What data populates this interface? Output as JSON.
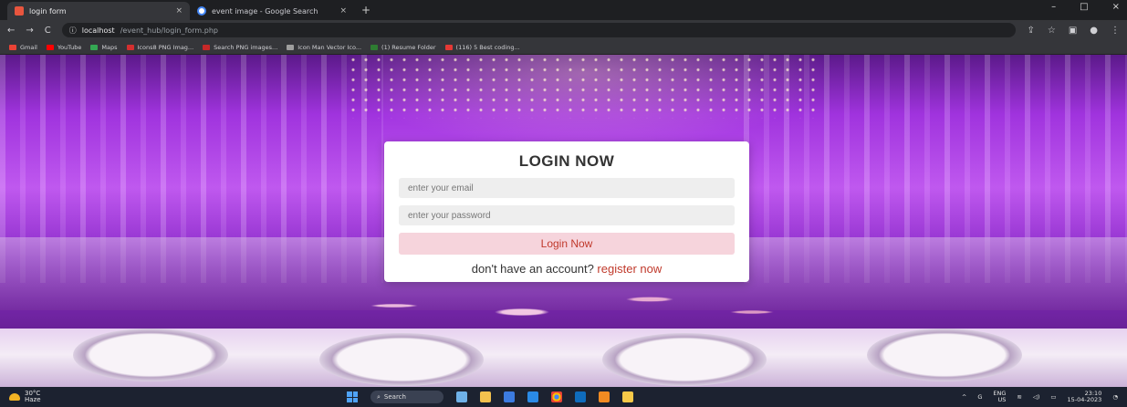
{
  "browser": {
    "tabs": [
      {
        "title": "login form",
        "active": true,
        "icon": "site-favicon"
      },
      {
        "title": "event image - Google Search",
        "active": false,
        "icon": "google-favicon"
      }
    ],
    "new_tab_symbol": "+",
    "close_symbol": "×",
    "window_controls": [
      "–",
      "□",
      "×"
    ],
    "url": {
      "host": "localhost",
      "path": "/event_hub/login_form.php"
    },
    "bookmarks": [
      "Gmail",
      "YouTube",
      "Maps",
      "Icons8 PNG Imag...",
      "Search PNG images...",
      "Icon Man Vector Ico...",
      "(1) Resume Folder",
      "(116) 5 Best coding..."
    ],
    "bookmark_colors": [
      "#ea4335",
      "#ff0000",
      "#34a853",
      "#d32f2f",
      "#c62828",
      "#9e9e9e",
      "#2e7d32",
      "#e53935"
    ]
  },
  "login": {
    "heading": "LOGIN NOW",
    "email_placeholder": "enter your email",
    "password_placeholder": "enter your password",
    "submit_label": "Login Now",
    "register_prompt": "don't have an account?",
    "register_link": "register now"
  },
  "taskbar": {
    "weather_temp": "30°C",
    "weather_desc": "Haze",
    "search_label": "Search",
    "lang": "ENG",
    "region": "US",
    "time": "23:10",
    "date": "15-04-2023"
  },
  "colors": {
    "accent": "#c0392b",
    "button_bg": "#f6d4dc",
    "field_bg": "#eeeeee"
  }
}
